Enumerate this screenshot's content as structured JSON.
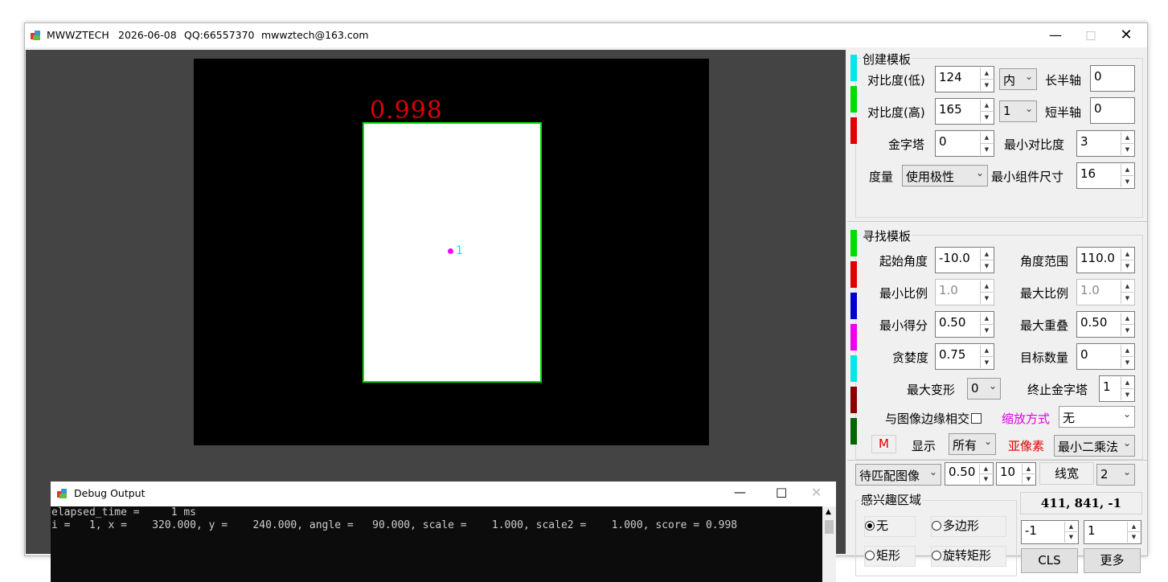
{
  "window": {
    "app_name": "MWWZTECH",
    "date": "2026-06-08",
    "qq": "QQ:66557370",
    "email": "mwwztech@163.com"
  },
  "image_view": {
    "score_text": "0.998",
    "point_label": "1"
  },
  "debug": {
    "title": "Debug Output",
    "lines": [
      "elapsed_time =     1 ms",
      "i =   1, x =    320.000, y =    240.000, angle =   90.000, scale =    1.000, scale2 =    1.000, score = 0.998"
    ]
  },
  "create_template": {
    "title": "创建模板",
    "contrast_low_label": "对比度(低)",
    "contrast_low": "124",
    "contrast_high_label": "对比度(高)",
    "contrast_high": "165",
    "pyramid_label": "金字塔",
    "pyramid": "0",
    "metric_label": "度量",
    "metric": "使用极性",
    "inner_select": "内",
    "level_select": "1",
    "major_axis_label": "长半轴",
    "major_axis": "0",
    "minor_axis_label": "短半轴",
    "minor_axis": "0",
    "min_contrast_label": "最小对比度",
    "min_contrast": "3",
    "min_comp_size_label": "最小组件尺寸",
    "min_comp_size": "16"
  },
  "find_template": {
    "title": "寻找模板",
    "start_angle_label": "起始角度",
    "start_angle": "-10.0",
    "angle_range_label": "角度范围",
    "angle_range": "110.0",
    "min_scale_label": "最小比例",
    "min_scale": "1.0",
    "max_scale_label": "最大比例",
    "max_scale": "1.0",
    "min_score_label": "最小得分",
    "min_score": "0.50",
    "max_overlap_label": "最大重叠",
    "max_overlap": "0.50",
    "greediness_label": "贪婪度",
    "greediness": "0.75",
    "num_targets_label": "目标数量",
    "num_targets": "0",
    "max_deform_label": "最大变形",
    "max_deform": "0",
    "stop_pyramid_label": "终止金字塔",
    "stop_pyramid": "1",
    "edge_intersect_label": "与图像边缘相交",
    "scale_mode_label": "缩放方式",
    "scale_mode": "无",
    "m_button": "M",
    "display_label": "显示",
    "display": "所有",
    "subpixel_label": "亚像素",
    "subpixel": "最小二乘法"
  },
  "bottom": {
    "image_select": "待匹配图像",
    "zoom": "0.50",
    "step": "10",
    "line_width_label": "线宽",
    "line_width": "2",
    "roi_title": "感兴趣区域",
    "roi_none": "无",
    "roi_polygon": "多边形",
    "roi_rect": "矩形",
    "roi_rot_rect": "旋转矩形",
    "coords": "411, 841, -1",
    "val_a": "-1",
    "val_b": "1",
    "cls_button": "CLS",
    "more_button": "更多"
  },
  "colors": {
    "strip_cyan": "#00e8e8",
    "strip_green": "#00dd00",
    "strip_red": "#e00000",
    "strip_blue": "#0000cc",
    "strip_magenta": "#ee00ee",
    "strip_darkred": "#880000",
    "strip_darkgreen": "#006600",
    "match_outline": "#00e400",
    "score_color": "#e00000"
  }
}
